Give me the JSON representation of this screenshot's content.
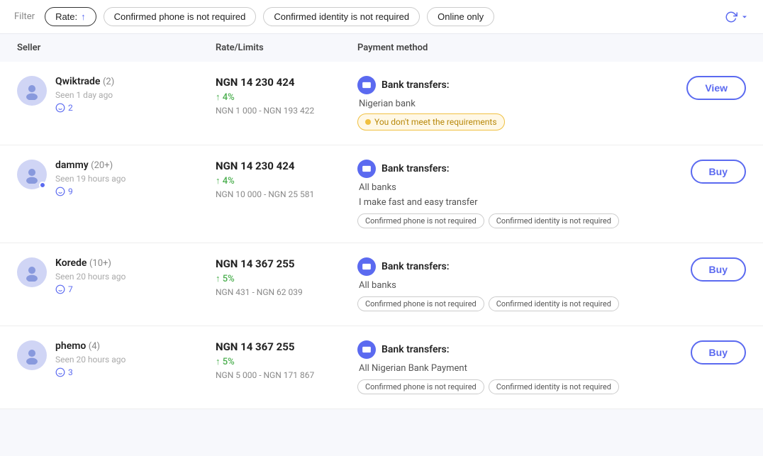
{
  "topbar": {
    "filter_label": "Filter",
    "rate_btn": "Rate:",
    "rate_arrow": "↑",
    "filter1": "Confirmed phone is not required",
    "filter2": "Confirmed identity is not required",
    "filter3": "Online only",
    "refresh_icon": "refresh-icon"
  },
  "table": {
    "col_seller": "Seller",
    "col_rate": "Rate/Limits",
    "col_payment": "Payment method"
  },
  "rows": [
    {
      "seller_name": "Qwiktrade",
      "seller_trades": "(2)",
      "seen": "Seen 1 day ago",
      "feedback": "2",
      "rate": "NGN 14 230 424",
      "percent": "↑ 4%",
      "limits": "NGN 1 000 - NGN 193 422",
      "payment_type": "Bank transfers:",
      "payment_sub": "Nigerian bank",
      "warning": "You don't meet the requirements",
      "tags": [],
      "action": "View",
      "has_online": false
    },
    {
      "seller_name": "dammy",
      "seller_trades": "(20+)",
      "seen": "Seen 19 hours ago",
      "feedback": "9",
      "rate": "NGN 14 230 424",
      "percent": "↑ 4%",
      "limits": "NGN 10 000 - NGN 25 581",
      "payment_type": "Bank transfers:",
      "payment_sub": "All banks\nI make fast and easy transfer",
      "warning": null,
      "tags": [
        "Confirmed phone is not required",
        "Confirmed identity is not required"
      ],
      "action": "Buy",
      "has_online": true
    },
    {
      "seller_name": "Korede",
      "seller_trades": "(10+)",
      "seen": "Seen 20 hours ago",
      "feedback": "7",
      "rate": "NGN 14 367 255",
      "percent": "↑ 5%",
      "limits": "NGN 431 - NGN 62 039",
      "payment_type": "Bank transfers:",
      "payment_sub": "All banks",
      "warning": null,
      "tags": [
        "Confirmed phone is not required",
        "Confirmed identity is not required"
      ],
      "action": "Buy",
      "has_online": false
    },
    {
      "seller_name": "phemo",
      "seller_trades": "(4)",
      "seen": "Seen 20 hours ago",
      "feedback": "3",
      "rate": "NGN 14 367 255",
      "percent": "↑ 5%",
      "limits": "NGN 5 000 - NGN 171 867",
      "payment_type": "Bank transfers:",
      "payment_sub": "All Nigerian Bank Payment",
      "warning": null,
      "tags": [
        "Confirmed phone is not required",
        "Confirmed identity is not required"
      ],
      "action": "Buy",
      "has_online": false
    }
  ]
}
